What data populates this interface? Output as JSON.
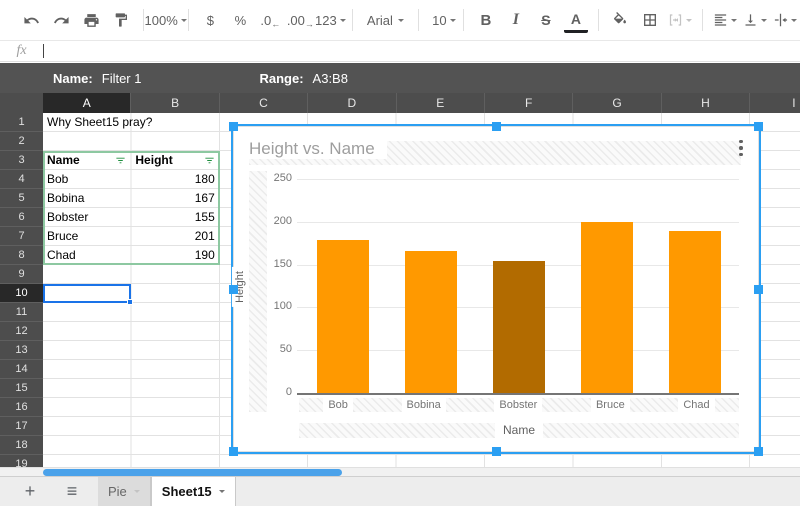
{
  "toolbar": {
    "zoom": "100%",
    "currency": "$",
    "percent": "%",
    "decrease_decimal": ".0",
    "increase_decimal": ".00",
    "number_format": "123",
    "font": "Arial",
    "font_size": "10",
    "bold": "B",
    "italic": "I",
    "strikethrough": "S",
    "text_color": "A"
  },
  "formula_bar": {
    "fx": "fx",
    "value": ""
  },
  "filter_bar": {
    "name_label": "Name:",
    "name_value": "Filter 1",
    "range_label": "Range:",
    "range_value": "A3:B8"
  },
  "grid": {
    "columns": [
      "A",
      "B",
      "C",
      "D",
      "E",
      "F",
      "G",
      "H",
      "I"
    ],
    "row_count": 19,
    "active_column": "A",
    "active_row": 10,
    "active_cell": "A10",
    "filter_range": "A3:B8",
    "cells": {
      "A1": "Why Sheet15 pray?",
      "A3": "Name",
      "B3": "Height",
      "A4": "Bob",
      "B4": "180",
      "A5": "Bobina",
      "B5": "167",
      "A6": "Bobster",
      "B6": "155",
      "A7": "Bruce",
      "B7": "201",
      "A8": "Chad",
      "B8": "190"
    }
  },
  "chart_data": {
    "type": "bar",
    "title": "Height vs. Name",
    "xlabel": "Name",
    "ylabel": "Height",
    "categories": [
      "Bob",
      "Bobina",
      "Bobster",
      "Bruce",
      "Chad"
    ],
    "values": [
      180,
      167,
      155,
      201,
      190
    ],
    "ylim": [
      0,
      250
    ],
    "yticks": [
      0,
      50,
      100,
      150,
      200,
      250
    ],
    "bar_colors": [
      "#ff9900",
      "#ff9900",
      "#b26b00",
      "#ff9900",
      "#ff9900"
    ],
    "grid": true,
    "legend": "none"
  },
  "tabs": {
    "add": "+",
    "all_sheets": "≡",
    "items": [
      {
        "label": "Pie",
        "active": false
      },
      {
        "label": "Sheet15",
        "active": true
      }
    ]
  },
  "colors": {
    "accent_blue": "#2b9ff2",
    "selection_blue": "#1a73e8",
    "bar_orange": "#ff9900",
    "bar_brown": "#b26b00",
    "filter_green": "#8dc8a1",
    "filter_icon_green": "#1e8e3e",
    "header_dark": "#4d4d4d",
    "filter_bar_dark": "#535353"
  }
}
